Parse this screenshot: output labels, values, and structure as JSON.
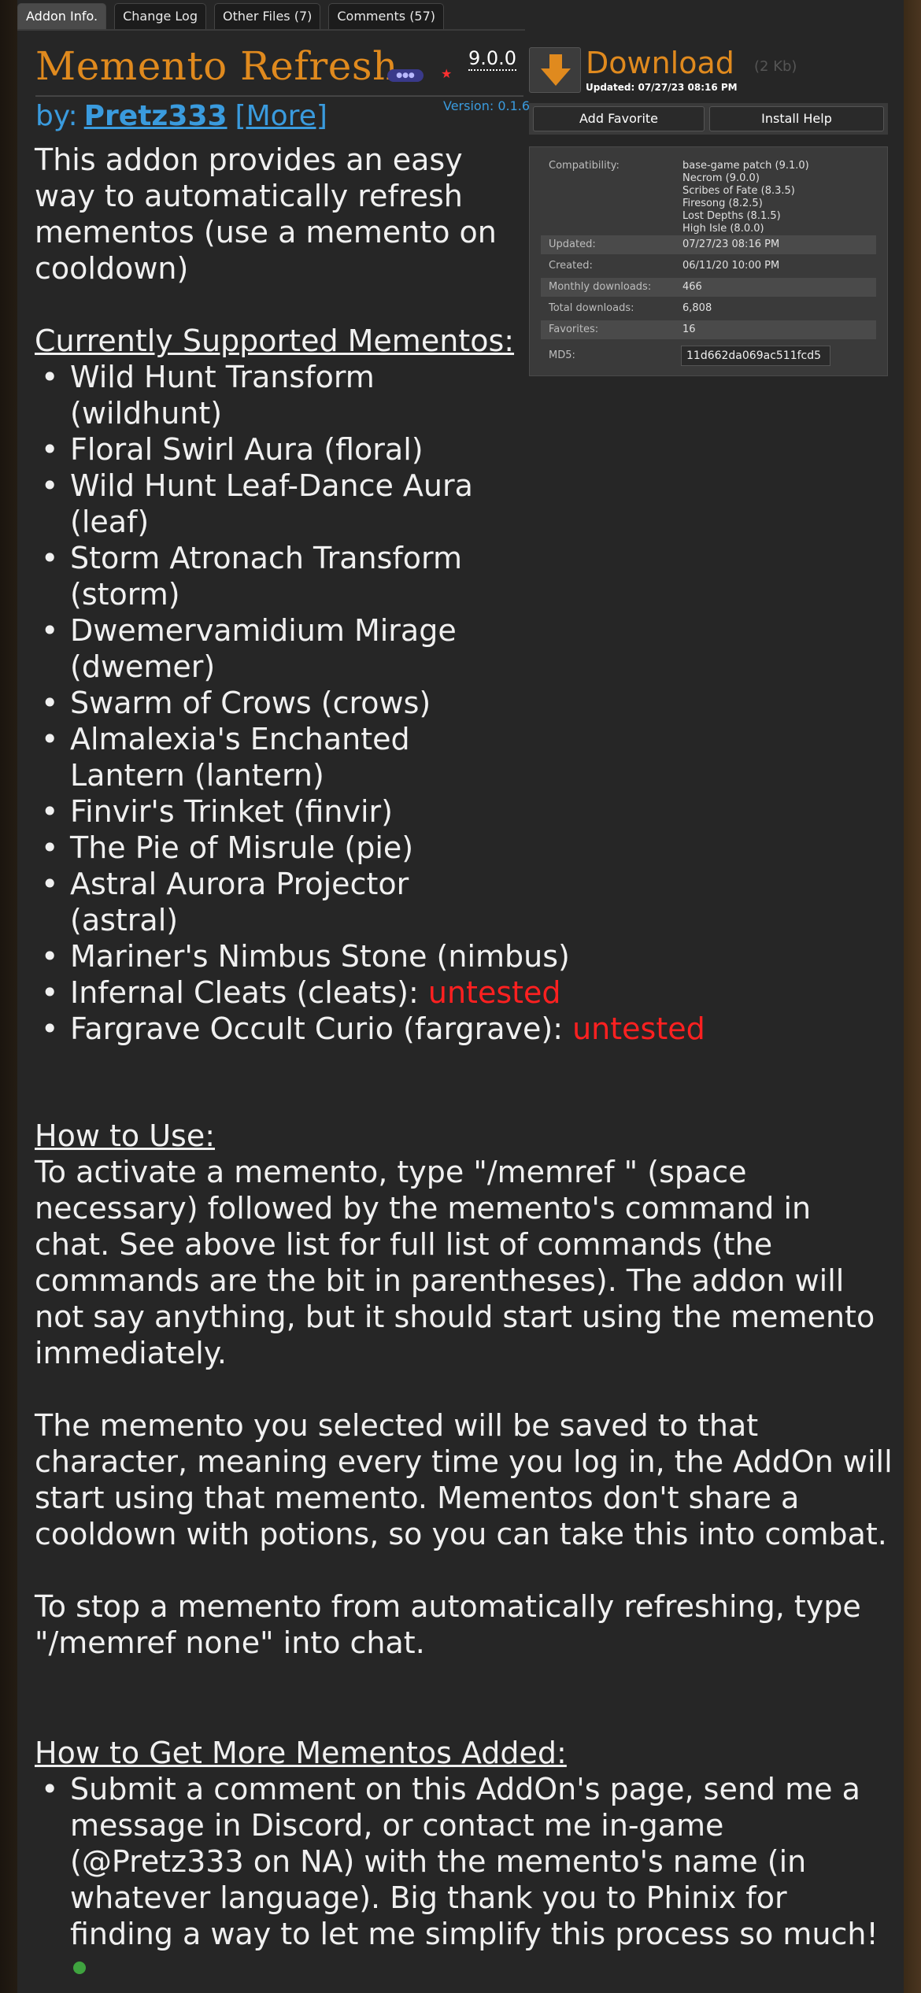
{
  "tabs": [
    {
      "label": "Addon Info."
    },
    {
      "label": "Change Log"
    },
    {
      "label": "Other Files (7)"
    },
    {
      "label": "Comments (57)"
    }
  ],
  "addon": {
    "title": "Memento Refresh",
    "game_version": "9.0.0",
    "addon_version": "Version: 0.1.6",
    "by_label": "by:",
    "author": "Pretz333",
    "more_label": "[More]"
  },
  "download": {
    "label": "Download",
    "size": "(2 Kb)",
    "updated": "Updated: 07/27/23 08:16 PM",
    "add_favorite": "Add Favorite",
    "install_help": "Install Help",
    "accent_color": "#e08a1e"
  },
  "info": {
    "compatibility_label": "Compatibility:",
    "compatibility": [
      "base-game patch (9.1.0)",
      "Necrom (9.0.0)",
      "Scribes of Fate (8.3.5)",
      "Firesong (8.2.5)",
      "Lost Depths (8.1.5)",
      "High Isle (8.0.0)"
    ],
    "rows": [
      {
        "label": "Updated:",
        "value": "07/27/23 08:16 PM"
      },
      {
        "label": "Created:",
        "value": "06/11/20 10:00 PM"
      },
      {
        "label": "Monthly downloads:",
        "value": "466"
      },
      {
        "label": "Total downloads:",
        "value": "6,808"
      },
      {
        "label": "Favorites:",
        "value": "16"
      }
    ],
    "md5_label": "MD5:",
    "md5_value": "11d662da069ac511fcd5"
  },
  "description": {
    "intro": "This addon provides an easy way to automatically refresh mementos (use a memento on cooldown)",
    "supported_heading": "Currently Supported Mementos:",
    "mementos": [
      {
        "text": "Wild Hunt Transform (wildhunt)",
        "status": ""
      },
      {
        "text": "Floral Swirl Aura (floral)",
        "status": ""
      },
      {
        "text": "Wild Hunt Leaf-Dance Aura (leaf)",
        "status": ""
      },
      {
        "text": "Storm Atronach Transform (storm)",
        "status": ""
      },
      {
        "text": "Dwemervamidium Mirage (dwemer)",
        "status": ""
      },
      {
        "text": "Swarm of Crows (crows)",
        "status": ""
      },
      {
        "text": "Almalexia's Enchanted Lantern (lantern)",
        "status": ""
      },
      {
        "text": "Finvir's Trinket (finvir)",
        "status": ""
      },
      {
        "text": "The Pie of Misrule (pie)",
        "status": ""
      },
      {
        "text": "Astral Aurora Projector (astral)",
        "status": ""
      },
      {
        "text": "Mariner's Nimbus Stone (nimbus)",
        "status": ""
      },
      {
        "text": "Infernal Cleats (cleats): ",
        "status": "untested"
      },
      {
        "text": "Fargrave Occult Curio (fargrave): ",
        "status": "untested"
      }
    ],
    "how_to_use_heading": "How to Use:",
    "how_to_use_p1": "To activate a memento, type \"/memref \" (space necessary) followed by the memento's command in chat. See above list for full list of commands (the commands are the bit in parentheses). The addon will not say anything, but it should start using the memento immediately.",
    "how_to_use_p2": "The memento you selected will be saved to that character, meaning every time you log in, the AddOn will start using that memento. Mementos don't share a cooldown with potions, so you can take this into combat.",
    "how_to_use_p3": "To stop a memento from automatically refreshing, type \"/memref none\" into chat.",
    "more_heading": "How to Get More Mementos Added:",
    "more_item": "Submit a comment on this AddOn's page, send me a message in Discord, or contact me in-game (@Pretz333 on NA) with the memento's name (in whatever language). Big thank you to Phinix for finding a way to let me simplify this process so much!",
    "untested_color": "#ff2020"
  }
}
